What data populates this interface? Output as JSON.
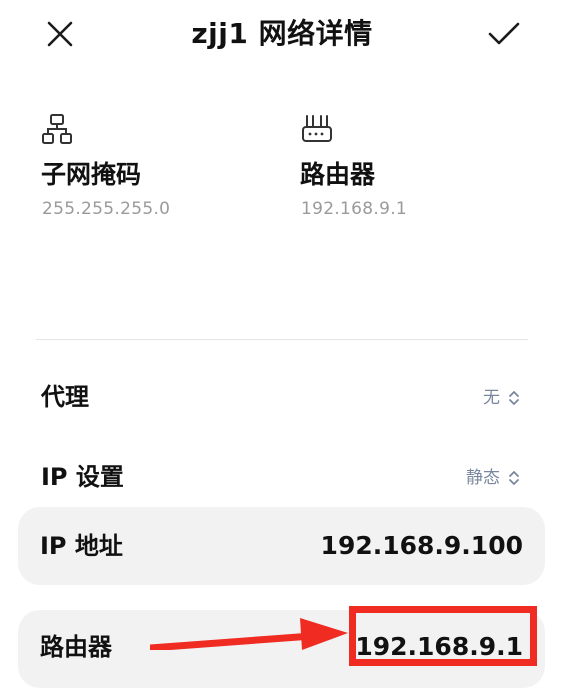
{
  "header": {
    "title": "zjj1 网络详情",
    "close_icon": "close-icon",
    "confirm_icon": "checkmark-icon"
  },
  "info": {
    "subnet": {
      "icon": "network-topology-icon",
      "label": "子网掩码",
      "value": "255.255.255.0"
    },
    "router": {
      "icon": "router-icon",
      "label": "路由器",
      "value": "192.168.9.1"
    }
  },
  "settings": {
    "proxy": {
      "label": "代理",
      "value": "无"
    },
    "ip_settings": {
      "label": "IP 设置",
      "value": "静态"
    }
  },
  "fields": {
    "ip_address": {
      "label": "IP 地址",
      "value": "192.168.9.100"
    },
    "router": {
      "label": "路由器",
      "value": "192.168.9.1"
    }
  },
  "colors": {
    "annotation": "#ef2b22",
    "field_background": "#f2f2f2",
    "secondary_text": "#9a9a9a",
    "value_text": "#7a879e"
  }
}
